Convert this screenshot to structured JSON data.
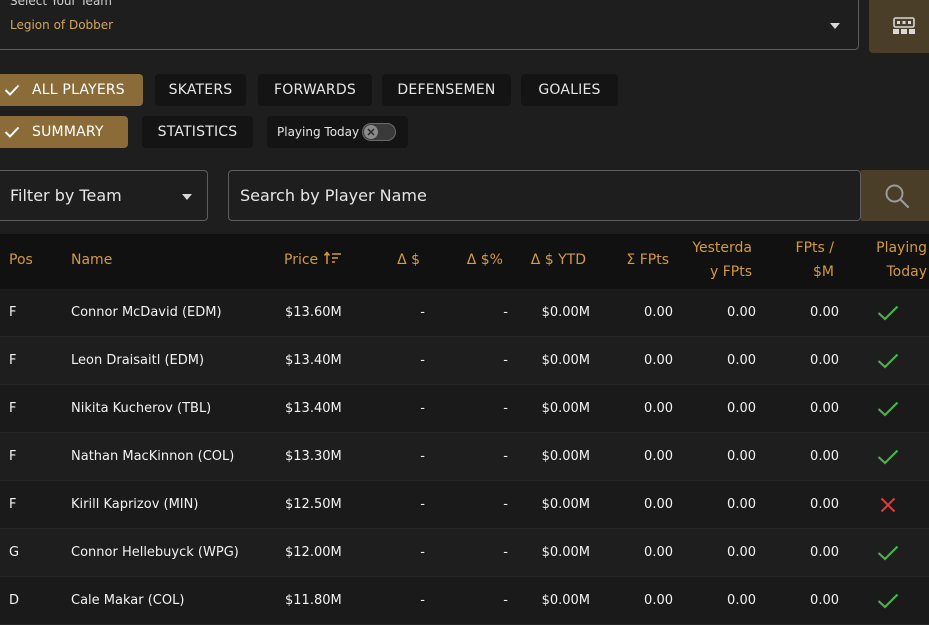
{
  "team_select": {
    "label": "Select Your Team",
    "value": "Legion of Dobber"
  },
  "position_filters": [
    {
      "label": "ALL PLAYERS",
      "active": true
    },
    {
      "label": "SKATERS",
      "active": false
    },
    {
      "label": "FORWARDS",
      "active": false
    },
    {
      "label": "DEFENSEMEN",
      "active": false
    },
    {
      "label": "GOALIES",
      "active": false
    }
  ],
  "view_filters": [
    {
      "label": "SUMMARY",
      "active": true
    },
    {
      "label": "STATISTICS",
      "active": false
    }
  ],
  "playing_today_toggle": {
    "label": "Playing Today",
    "on": false
  },
  "filter_team": {
    "label": "Filter by Team"
  },
  "search": {
    "placeholder": "Search by Player Name"
  },
  "table": {
    "headers": {
      "pos": "Pos",
      "name": "Name",
      "price": "Price",
      "delta_dollar": "Δ $",
      "delta_pct": "Δ $%",
      "delta_ytd": "Δ $ YTD",
      "sum_fpts": "Σ FPts",
      "yesterday_line1": "Yesterda",
      "yesterday_line2": "y FPts",
      "fpts_m_line1": "FPts /",
      "fpts_m_line2": "$M",
      "playing_line1": "Playing",
      "playing_line2": "Today"
    },
    "rows": [
      {
        "pos": "F",
        "name": "Connor McDavid (EDM)",
        "price": "$13.60M",
        "d": "-",
        "dp": "-",
        "ytd": "$0.00M",
        "fpts": "0.00",
        "yfpts": "0.00",
        "fpm": "0.00",
        "playing": true
      },
      {
        "pos": "F",
        "name": "Leon Draisaitl (EDM)",
        "price": "$13.40M",
        "d": "-",
        "dp": "-",
        "ytd": "$0.00M",
        "fpts": "0.00",
        "yfpts": "0.00",
        "fpm": "0.00",
        "playing": true
      },
      {
        "pos": "F",
        "name": "Nikita Kucherov (TBL)",
        "price": "$13.40M",
        "d": "-",
        "dp": "-",
        "ytd": "$0.00M",
        "fpts": "0.00",
        "yfpts": "0.00",
        "fpm": "0.00",
        "playing": true
      },
      {
        "pos": "F",
        "name": "Nathan MacKinnon (COL)",
        "price": "$13.30M",
        "d": "-",
        "dp": "-",
        "ytd": "$0.00M",
        "fpts": "0.00",
        "yfpts": "0.00",
        "fpm": "0.00",
        "playing": true
      },
      {
        "pos": "F",
        "name": "Kirill Kaprizov (MIN)",
        "price": "$12.50M",
        "d": "-",
        "dp": "-",
        "ytd": "$0.00M",
        "fpts": "0.00",
        "yfpts": "0.00",
        "fpm": "0.00",
        "playing": false
      },
      {
        "pos": "G",
        "name": "Connor Hellebuyck (WPG)",
        "price": "$12.00M",
        "d": "-",
        "dp": "-",
        "ytd": "$0.00M",
        "fpts": "0.00",
        "yfpts": "0.00",
        "fpm": "0.00",
        "playing": true
      },
      {
        "pos": "D",
        "name": "Cale Makar (COL)",
        "price": "$11.80M",
        "d": "-",
        "dp": "-",
        "ytd": "$0.00M",
        "fpts": "0.00",
        "yfpts": "0.00",
        "fpm": "0.00",
        "playing": true
      }
    ]
  },
  "colors": {
    "accent": "#8b6c38",
    "header_text": "#d49a40",
    "check": "#4caf50",
    "cross": "#e53935"
  },
  "icons": {
    "lineup": "lineup-icon",
    "search": "search-icon",
    "sort": "sort-ascending-icon",
    "check": "check-icon",
    "cross": "close-icon"
  }
}
